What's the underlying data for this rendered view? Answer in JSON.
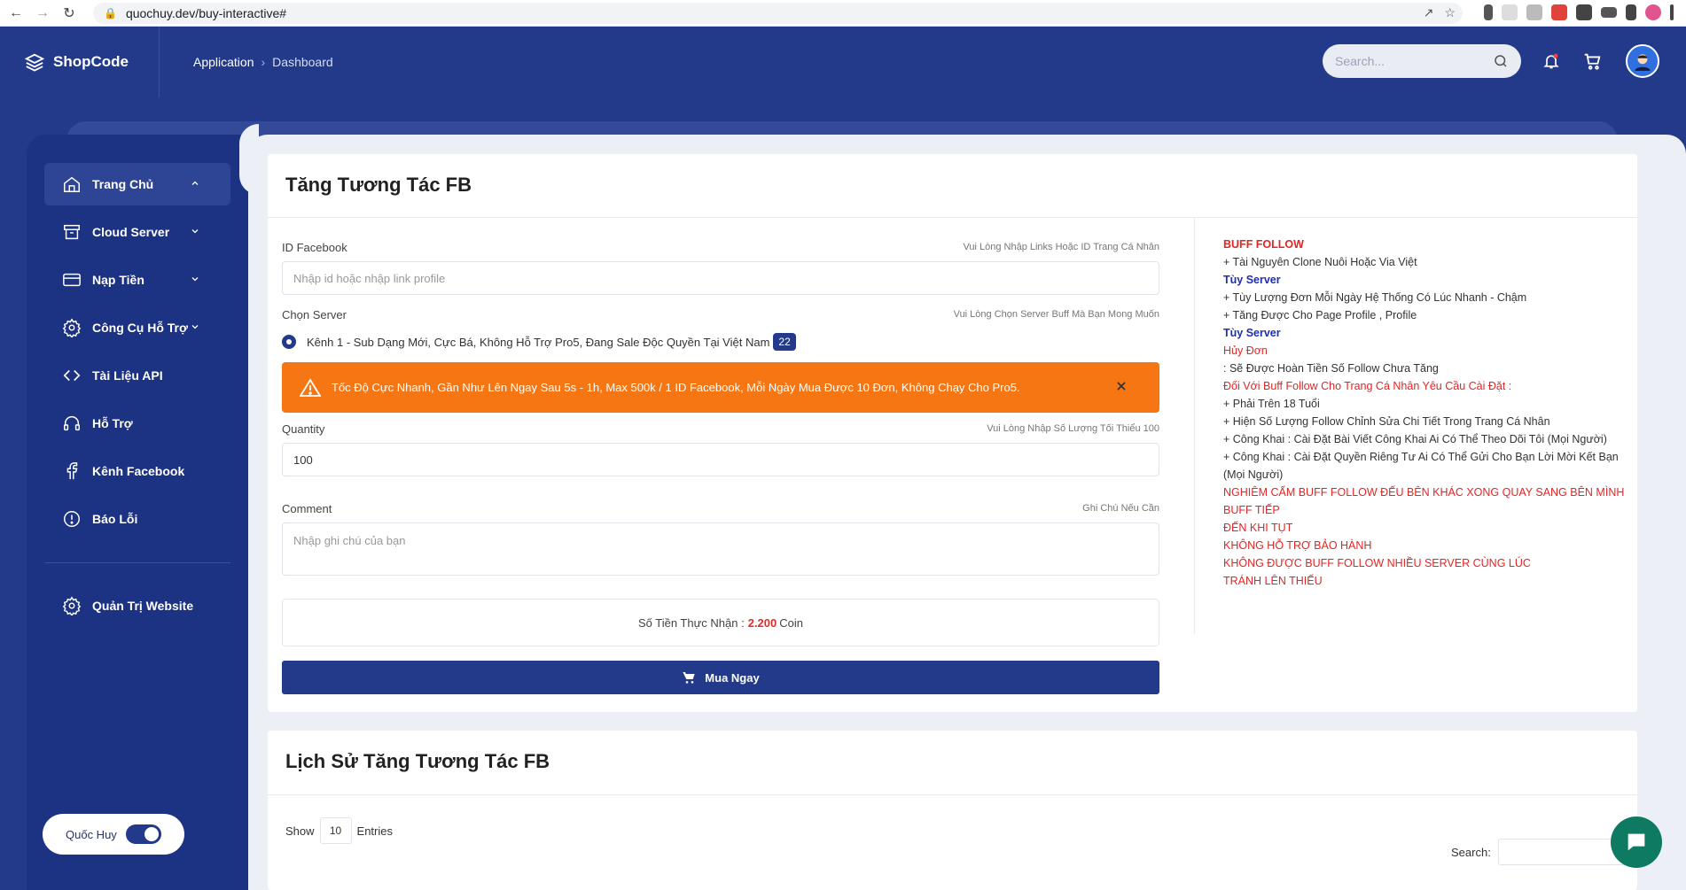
{
  "browser": {
    "url": "quochuy.dev/buy-interactive#"
  },
  "header": {
    "brand": "ShopCode",
    "breadcrumb": [
      "Application",
      "Dashboard"
    ],
    "search_placeholder": "Search..."
  },
  "sidebar": {
    "items": [
      {
        "label": "Trang Chủ",
        "icon": "home-icon",
        "expanded": true
      },
      {
        "label": "Cloud Server",
        "icon": "archive-box-icon"
      },
      {
        "label": "Nạp Tiền",
        "icon": "credit-card-icon"
      },
      {
        "label": "Công Cụ Hỗ Trợ",
        "icon": "gear-icon"
      },
      {
        "label": "Tài Liệu API",
        "icon": "code-icon"
      },
      {
        "label": "Hỗ Trợ",
        "icon": "headset-icon"
      },
      {
        "label": "Kênh Facebook",
        "icon": "facebook-icon"
      },
      {
        "label": "Báo Lỗi",
        "icon": "alert-circle-icon"
      }
    ],
    "admin_label": "Quản Trị Website",
    "user_name": "Quốc Huy"
  },
  "order_form": {
    "title": "Tăng Tương Tác FB",
    "id_label": "ID Facebook",
    "id_hint": "Vui Lòng Nhập Links Hoặc ID Trang Cá Nhân",
    "id_placeholder": "Nhập id hoặc nhập link profile",
    "server_label": "Chọn Server",
    "server_hint": "Vui Lòng Chọn Server Buff Mà Bạn Mong Muốn",
    "server_option": "Kênh 1 - Sub Dạng Mới, Cực Bá, Không Hỗ Trợ Pro5, Đang Sale Độc Quyền Tại Việt Nam",
    "server_price": "22",
    "alert_text": "Tốc Độ Cực Nhanh, Gần Như Lên Ngay Sau 5s - 1h, Max 500k / 1 ID Facebook, Mỗi Ngày Mua Được 10 Đơn, Không Chạy Cho Pro5.",
    "quantity_label": "Quantity",
    "quantity_hint": "Vui Lòng Nhập Số Lượng Tối Thiểu 100",
    "quantity_value": "100",
    "comment_label": "Comment",
    "comment_hint": "Ghi Chú Nếu Cần",
    "comment_placeholder": "Nhập ghi chú của bạn",
    "total_prefix": "Số Tiền Thực Nhận :",
    "total_amount": "2.200",
    "total_unit": "Coin",
    "buy_label": "Mua Ngay"
  },
  "notes": [
    {
      "text": "BUFF FOLLOW",
      "style": "redb"
    },
    {
      "text": "+ Tài Nguyên Clone Nuôi Hoặc Via Việt",
      "style": "normal"
    },
    {
      "text": "Tùy Server",
      "style": "blue"
    },
    {
      "text": "+ Tùy Lượng Đơn Mỗi Ngày Hệ Thống Có Lúc Nhanh - Chậm",
      "style": "normal"
    },
    {
      "text": "+ Tăng Được Cho Page Profile , Profile",
      "style": "normal"
    },
    {
      "text": "Tùy Server",
      "style": "blue"
    },
    {
      "text": "Hủy Đơn",
      "style": "red"
    },
    {
      "text": ": Sẽ Được Hoàn Tiền Số Follow Chưa Tăng",
      "style": "normal"
    },
    {
      "text": "Đối Với Buff Follow Cho Trang Cá Nhân Yêu Cầu Cài Đặt :",
      "style": "red"
    },
    {
      "text": "+ Phải Trên 18 Tuổi",
      "style": "normal"
    },
    {
      "text": "+ Hiện Số Lượng Follow Chỉnh Sửa Chi Tiết Trong Trang Cá Nhân",
      "style": "normal"
    },
    {
      "text": "+ Công Khai : Cài Đặt Bài Viết Công Khai Ai Có Thể Theo Dõi Tôi (Mọi Người)",
      "style": "normal"
    },
    {
      "text": "+ Công Khai : Cài Đặt Quyền Riêng Tư Ai Có Thể Gửi Cho Bạn Lời Mời Kết Bạn (Mọi Người)",
      "style": "normal"
    },
    {
      "text": "NGHIÊM CẤM BUFF FOLLOW ĐẾU BÊN KHÁC XONG QUAY SANG BÊN MÌNH BUFF TIẾP",
      "style": "red"
    },
    {
      "text": "ĐẾN KHI TỤT",
      "style": "red"
    },
    {
      "text": "KHÔNG HỖ TRỢ BẢO HÀNH",
      "style": "red"
    },
    {
      "text": "KHÔNG ĐƯỢC BUFF FOLLOW NHIỀU SERVER CÙNG LÚC",
      "style": "red"
    },
    {
      "text": "TRÁNH LÊN THIẾU",
      "style": "red"
    }
  ],
  "history": {
    "title": "Lịch Sử Tăng Tương Tác FB",
    "show_label": "Show",
    "entries_value": "10",
    "entries_label": "Entries",
    "search_label": "Search:"
  }
}
